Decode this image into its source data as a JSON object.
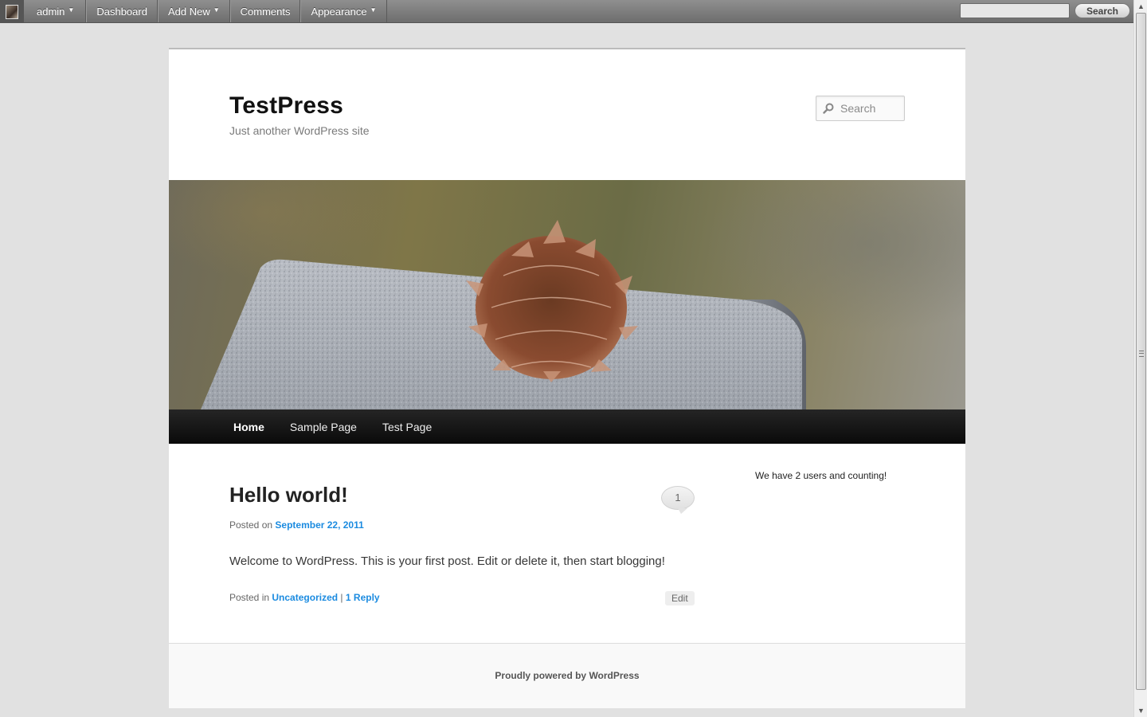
{
  "admin_bar": {
    "items": [
      {
        "label": "admin",
        "dropdown": true
      },
      {
        "label": "Dashboard",
        "dropdown": false
      },
      {
        "label": "Add New",
        "dropdown": true
      },
      {
        "label": "Comments",
        "dropdown": false
      },
      {
        "label": "Appearance",
        "dropdown": true
      }
    ],
    "search_value": "",
    "search_button": "Search",
    "caret": "▼"
  },
  "site": {
    "title": "TestPress",
    "description": "Just another WordPress site",
    "search_placeholder": "Search"
  },
  "nav": {
    "items": [
      "Home",
      "Sample Page",
      "Test Page"
    ],
    "active": "Home"
  },
  "post": {
    "title": "Hello world!",
    "comment_count": "1",
    "posted_on_prefix": "Posted on",
    "date": "September 22, 2011",
    "body": "Welcome to WordPress. This is your first post. Edit or delete it, then start blogging!",
    "posted_in_prefix": "Posted in",
    "category": "Uncategorized",
    "separator": "|",
    "reply_link": "1 Reply",
    "edit_label": "Edit"
  },
  "sidebar": {
    "widget_text": "We have 2 users and counting!"
  },
  "footer": {
    "text": "Proudly powered by WordPress"
  },
  "colors": {
    "link": "#1b8be0",
    "nav_bg": "#111111",
    "page_bg": "#e1e1e1"
  },
  "icons": {
    "header_search": "search-icon",
    "avatar": "avatar"
  }
}
